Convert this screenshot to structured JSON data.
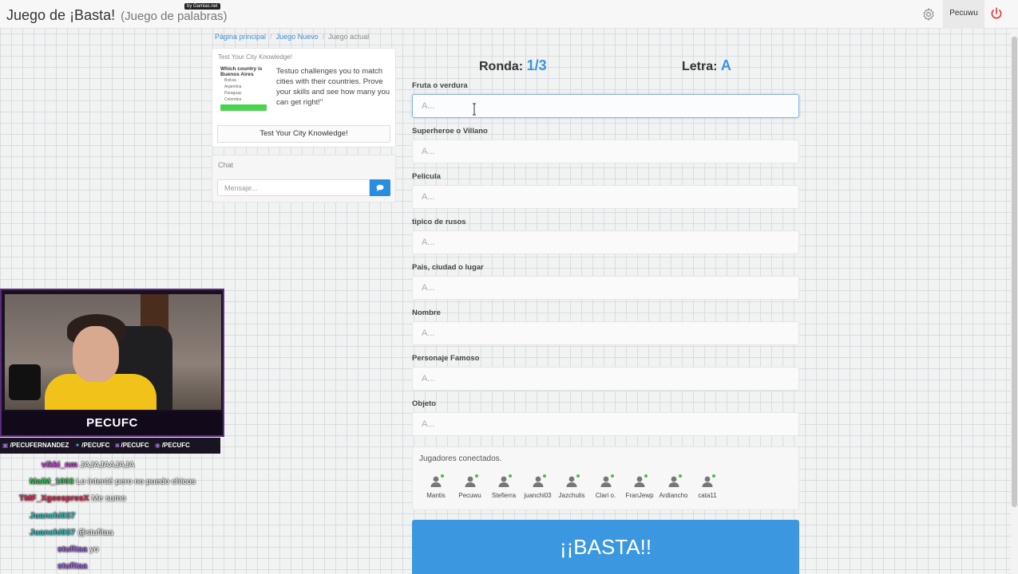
{
  "header": {
    "title": "Juego de ¡Basta!",
    "subtitle": "(Juego de palabras)",
    "badge": "by Gamias.net",
    "user": "Pecuwu"
  },
  "breadcrumb": {
    "home": "Página principal",
    "new_game": "Juego Nuevo",
    "current": "Juego actual"
  },
  "ad": {
    "title": "Test Your City Knowledge!",
    "thumb_question": "Which country is Buenos Aires",
    "thumb_options": [
      "Bolivia",
      "Argentina",
      "Paraguay",
      "Colombia"
    ],
    "text": "Testuo challenges you to match cities with their countries. Prove your skills and see how many you can get right!\"",
    "button": "Test Your City Knowledge!"
  },
  "chat": {
    "title": "Chat",
    "placeholder": "Mensaje..."
  },
  "game": {
    "round_label": "Ronda:",
    "round_value": "1/3",
    "letter_label": "Letra:",
    "letter_value": "A",
    "fields": [
      {
        "label": "Fruta o verdura",
        "placeholder": "A..."
      },
      {
        "label": "Superheroe o Villano",
        "placeholder": "A..."
      },
      {
        "label": "Pelicula",
        "placeholder": "A..."
      },
      {
        "label": "tipico de rusos",
        "placeholder": "A..."
      },
      {
        "label": "Pais, ciudad o lugar",
        "placeholder": "A..."
      },
      {
        "label": "Nombre",
        "placeholder": "A..."
      },
      {
        "label": "Personaje Famoso",
        "placeholder": "A..."
      },
      {
        "label": "Objeto",
        "placeholder": "A..."
      }
    ],
    "players_title": "Jugadores conectados.",
    "players": [
      "Mantis",
      "Pecuwu",
      "Stefierra",
      "juanchi03",
      "Jazchulis",
      "Clari o.",
      "FranJewp",
      "Ardiancho",
      "cata11"
    ],
    "basta_button": "¡¡BASTA!!"
  },
  "stream": {
    "cam_label": "PECUFC",
    "socials": [
      "/PECUFERNANDEZ",
      "/PECUFC",
      "/PECUFC",
      "/PECUFC"
    ],
    "chat": [
      {
        "user": "vikki_nm",
        "msg": "JAJAJAAJAJA",
        "color": "#c43bd6"
      },
      {
        "user": "MaiM_1003",
        "msg": "Lo intenté pero no puedo chicos",
        "color": "#39c95a"
      },
      {
        "user": "TMF_XgeespresX",
        "msg": "Me sumo",
        "color": "#e0325a"
      },
      {
        "user": "Juanchi037",
        "msg": "",
        "color": "#2bc5c5"
      },
      {
        "user": "Juanchi037",
        "msg": "@stufitaa",
        "color": "#2bc5c5"
      },
      {
        "user": "stufitaa",
        "msg": "yo",
        "color": "#9b5de5"
      },
      {
        "user": "stufitaa",
        "msg": "",
        "color": "#9b5de5"
      }
    ]
  },
  "colors": {
    "accent": "#3b98e0",
    "online": "#4dbb4d",
    "power": "#e53935"
  }
}
